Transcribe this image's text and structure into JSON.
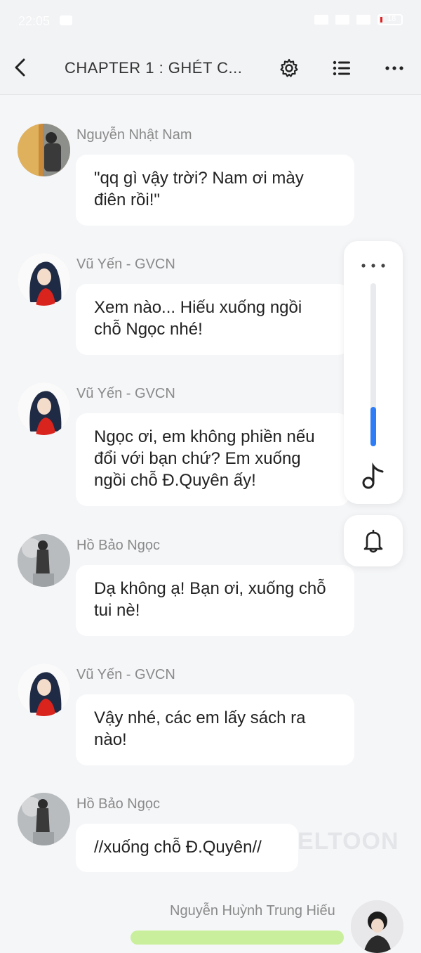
{
  "status": {
    "time": "22:05",
    "battery": "18"
  },
  "header": {
    "title": "CHAPTER 1 : GHÉT C..."
  },
  "messages": [
    {
      "name": "Nguyễn Nhật Nam",
      "text": "\"qq gì vậy trời? Nam ơi mày điên rồi!\""
    },
    {
      "name": "Vũ Yến - GVCN",
      "text": "Xem nào... Hiếu xuống ngồi chỗ Ngọc nhé!"
    },
    {
      "name": "Vũ Yến - GVCN",
      "text": "Ngọc ơi, em không phiền nếu đổi với bạn chứ? Em xuống ngồi chỗ Đ.Quyên ấy!"
    },
    {
      "name": "Hồ Bảo Ngọc",
      "text": "Dạ không ạ! Bạn ơi, xuống chỗ tui nè!"
    },
    {
      "name": "Vũ Yến - GVCN",
      "text": "Vậy nhé, các em lấy sách ra nào!"
    },
    {
      "name": "Hồ Bảo Ngọc",
      "text": "//xuống chỗ Đ.Quyên//"
    },
    {
      "name": "Nguyễn Huỳnh Trung Hiếu",
      "text": ""
    }
  ],
  "side_panel": {
    "scroll_progress": 0.24
  },
  "watermark": "ELTOON",
  "colors": {
    "accent": "#2e7cf6",
    "bubble": "#ffffff",
    "self_bubble": "#c9ef9c",
    "background": "#f5f6f8"
  },
  "icons": [
    "back-arrow-icon",
    "gear-icon",
    "list-icon",
    "more-dots-icon",
    "music-note-icon",
    "bell-icon"
  ]
}
